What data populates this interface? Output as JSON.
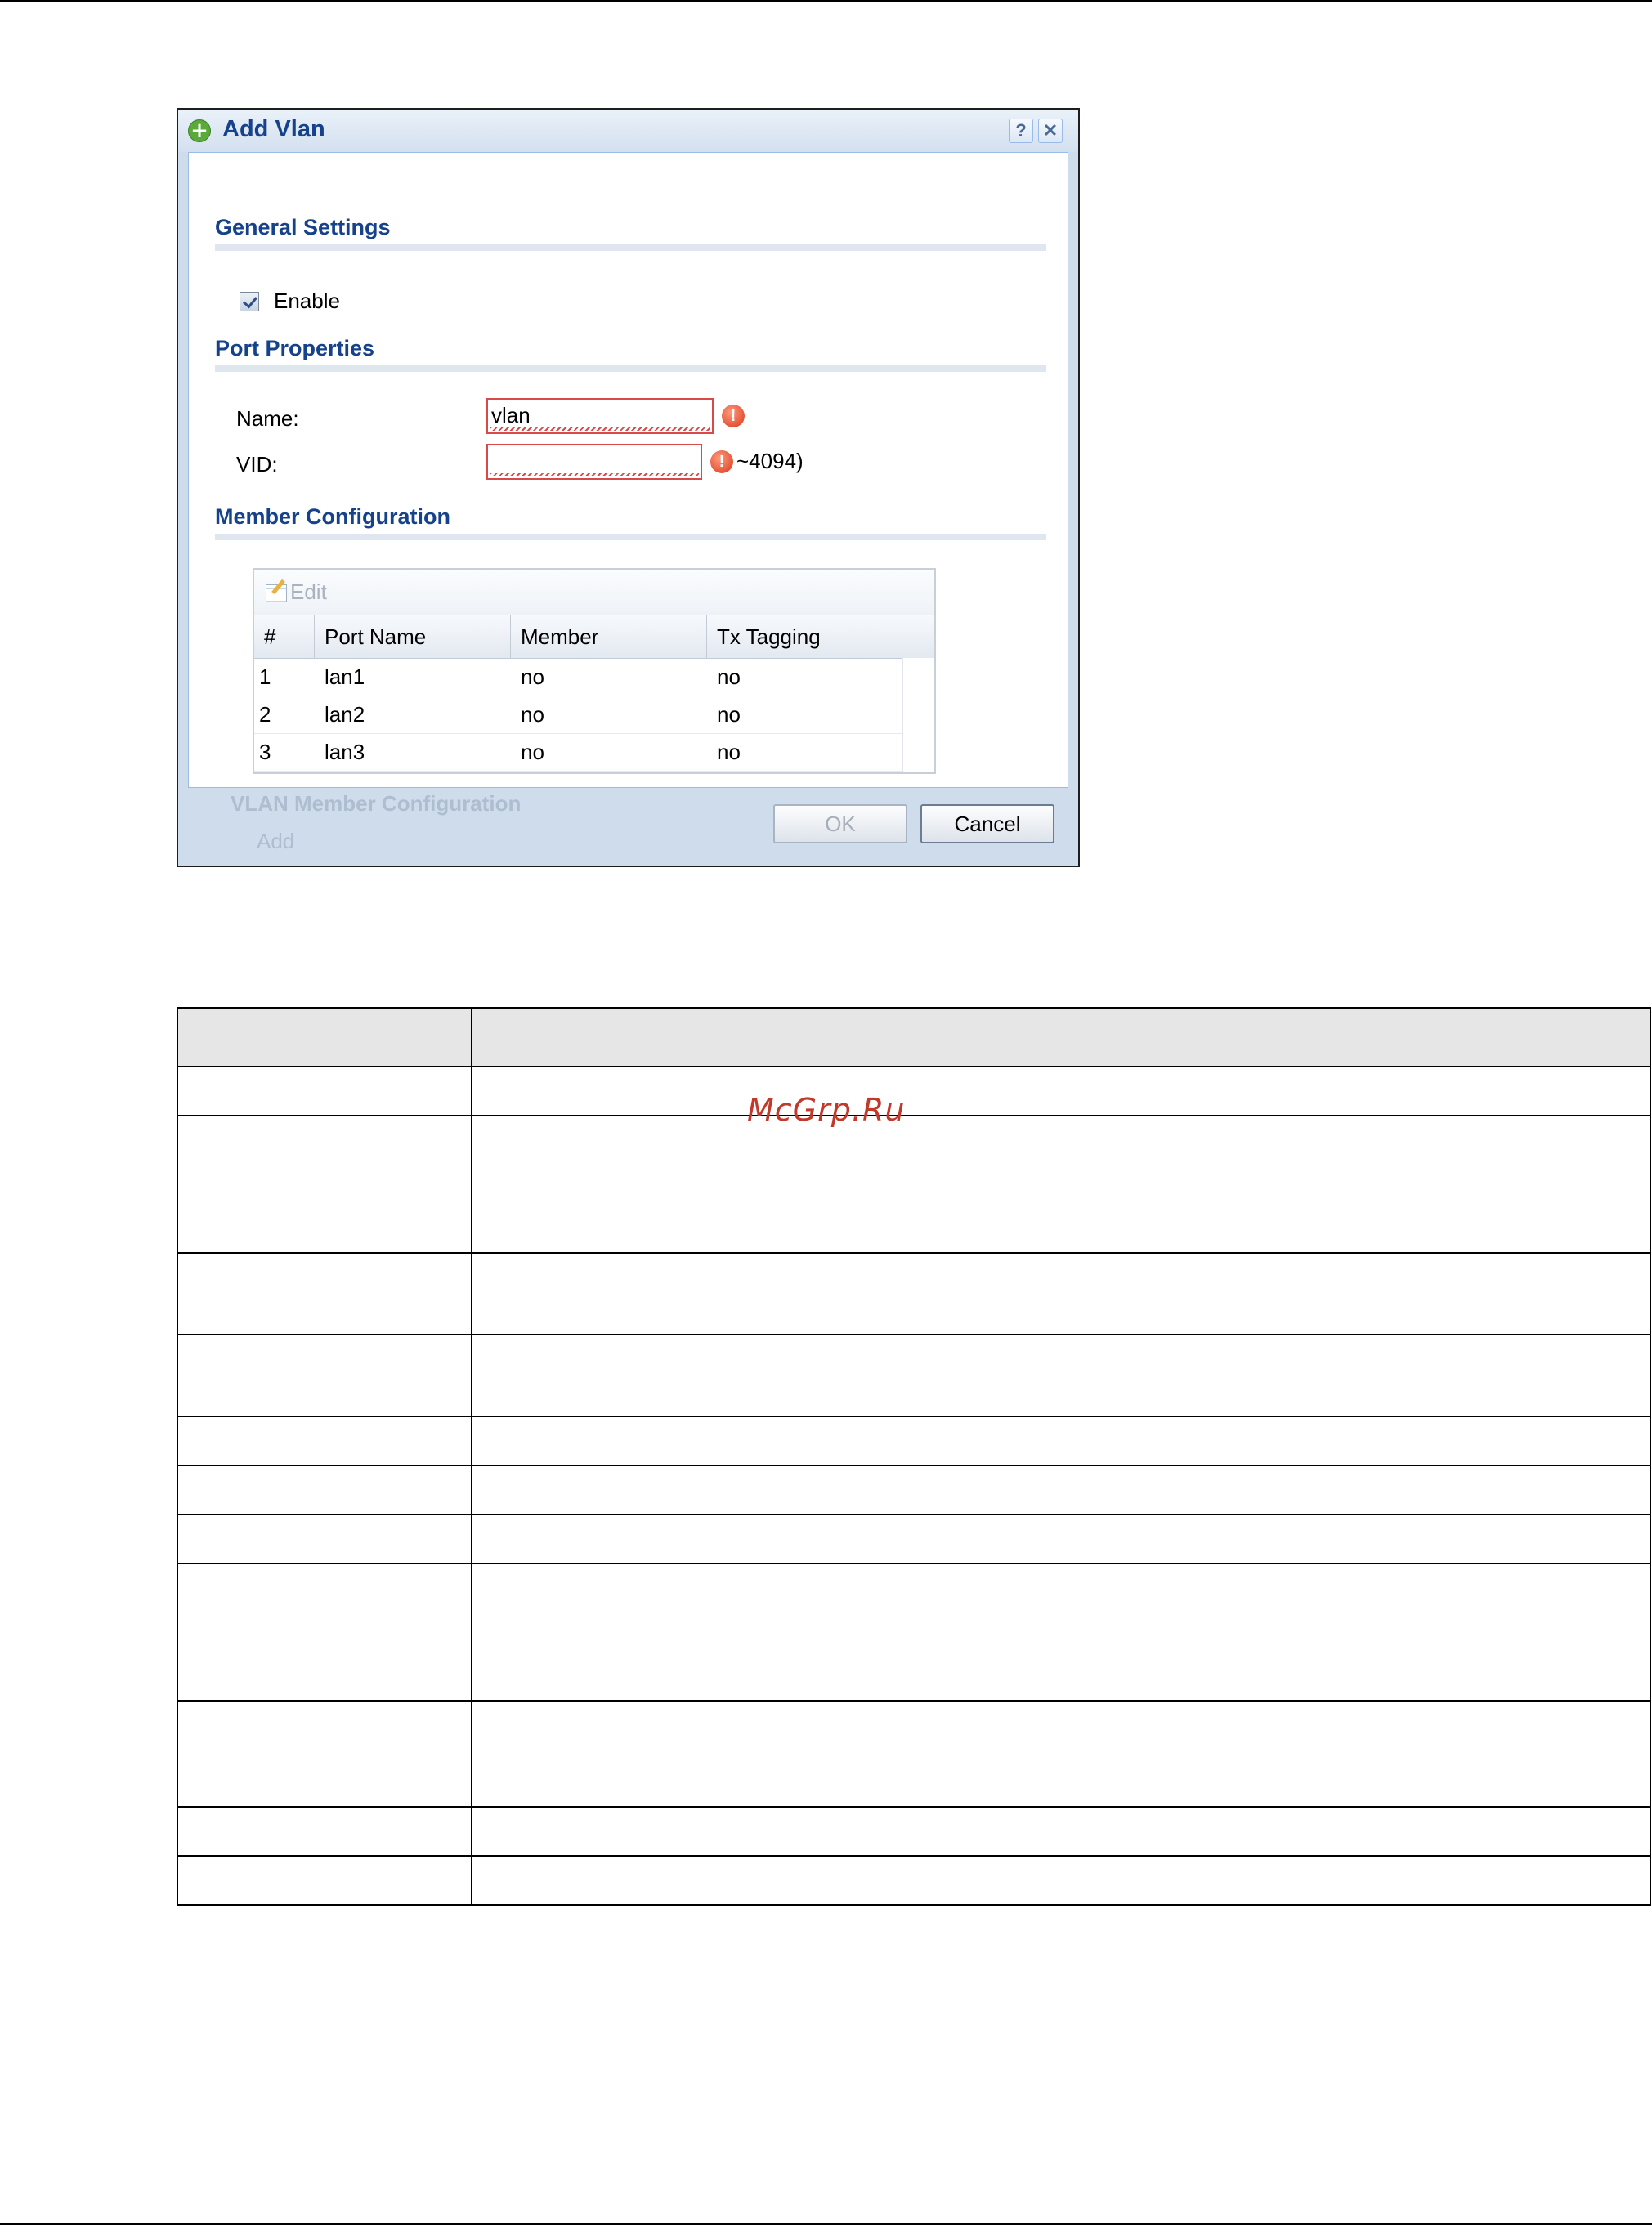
{
  "dialog": {
    "title": "Add Vlan",
    "help_label": "?",
    "close_label": "✕",
    "general_settings": {
      "heading": "General Settings",
      "enable_label": "Enable",
      "enable_checked": true
    },
    "port_properties": {
      "heading": "Port Properties",
      "name_label": "Name:",
      "name_value": "vlan",
      "vid_label": "VID:",
      "vid_value": "",
      "vid_range_hint": "~4094)",
      "error_icon_glyph": "!"
    },
    "member_configuration": {
      "heading": "Member Configuration",
      "edit_label": "Edit",
      "columns": [
        "#",
        "Port Name",
        "Member",
        "Tx Tagging"
      ],
      "rows": [
        [
          "1",
          "lan1",
          "no",
          "no"
        ],
        [
          "2",
          "lan2",
          "no",
          "no"
        ],
        [
          "3",
          "lan3",
          "no",
          "no"
        ]
      ]
    },
    "background": {
      "heading": "VLAN Member Configuration",
      "add_label": "Add"
    },
    "ok_label": "OK",
    "cancel_label": "Cancel"
  },
  "watermark": "McGrp.Ru",
  "colors": {
    "title_blue": "#15428b",
    "error_red": "#d84a4a",
    "panel_border": "#99bbe8"
  }
}
